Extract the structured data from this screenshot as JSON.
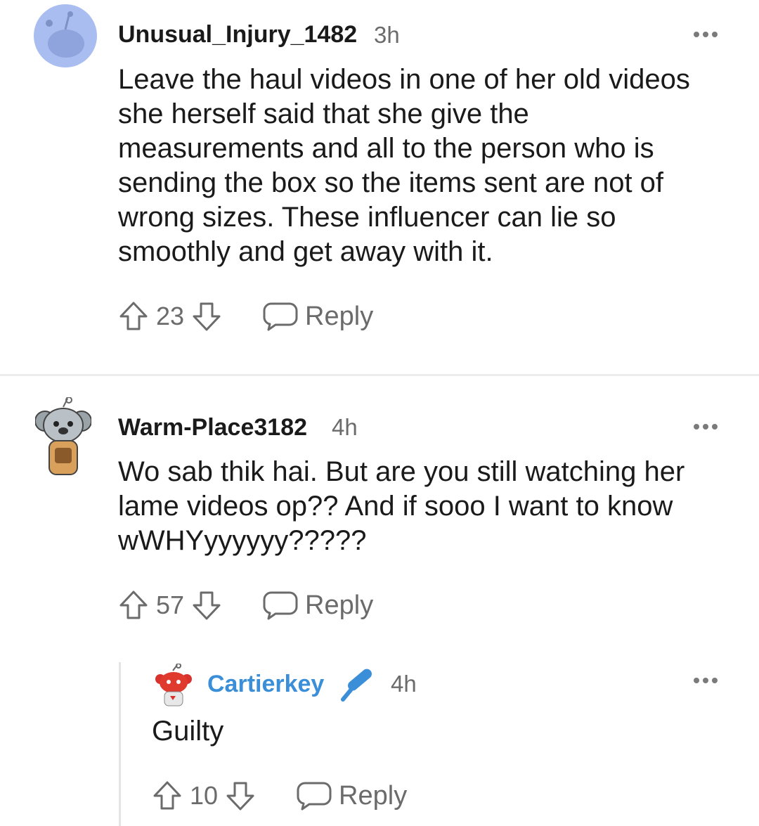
{
  "comments": [
    {
      "username": "Unusual_Injury_1482",
      "time": "3h",
      "lines": [
        "Leave the haul videos in one of her old videos",
        "she herself said that she give the",
        "measurements and all to the person who is",
        "sending the box so the items sent are not of",
        "wrong sizes. These influencer can lie so",
        "smoothly and get away with it."
      ],
      "score": "23",
      "reply_label": "Reply",
      "avatar_icon": "snoo-avatar-default"
    },
    {
      "username": "Warm-Place3182",
      "time": "4h",
      "lines": [
        "Wo sab thik hai. But are you still watching her",
        "lame videos op?? And if sooo I want to know",
        "wWHYyyyyyy?????"
      ],
      "score": "57",
      "reply_label": "Reply",
      "avatar_icon": "koala-snoo-avatar"
    },
    {
      "username": "Cartierkey",
      "time": "4h",
      "lines": [
        "Guilty"
      ],
      "score": "10",
      "reply_label": "Reply",
      "avatar_icon": "red-snoo-avatar",
      "op_icon": "microphone-icon",
      "username_color": "#3a8fd8"
    }
  ]
}
